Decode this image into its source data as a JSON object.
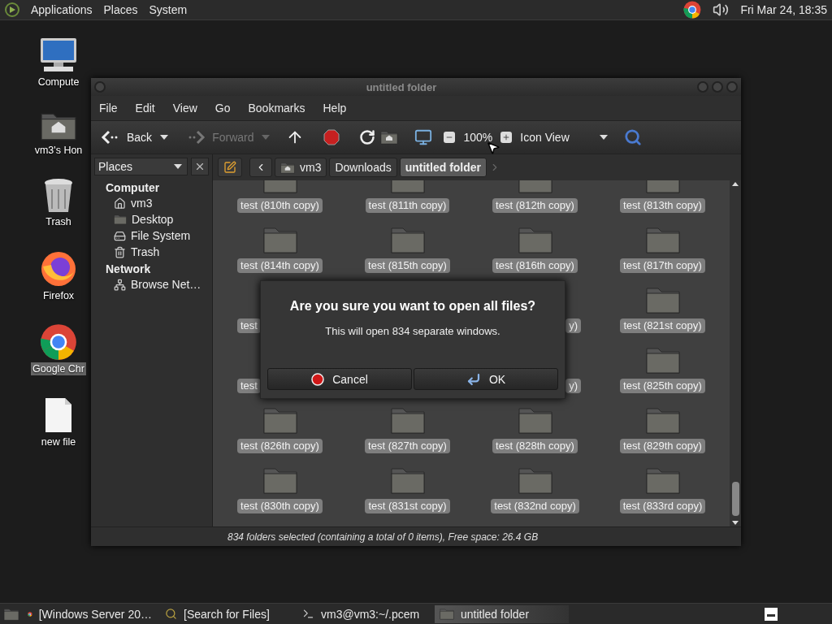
{
  "top_panel": {
    "menus": [
      "Applications",
      "Places",
      "System"
    ],
    "clock": "Fri Mar 24, 18:35"
  },
  "desktop_icons": [
    {
      "kind": "computer",
      "label": "Compute",
      "selected": false
    },
    {
      "kind": "home",
      "label": "vm3's Hon",
      "selected": false
    },
    {
      "kind": "trash",
      "label": "Trash",
      "selected": false
    },
    {
      "kind": "firefox",
      "label": "Firefox",
      "selected": false
    },
    {
      "kind": "chrome",
      "label": "Google Chr",
      "selected": true
    },
    {
      "kind": "file",
      "label": "new file",
      "selected": false
    }
  ],
  "window": {
    "title": "untitled folder",
    "menu": [
      "File",
      "Edit",
      "View",
      "Go",
      "Bookmarks",
      "Help"
    ],
    "toolbar": {
      "back": "Back",
      "forward": "Forward",
      "forward_disabled": true,
      "zoom": "100%",
      "view": "Icon View"
    },
    "sidebar": {
      "header": "Places",
      "sections": [
        {
          "title": "Computer",
          "children": [
            {
              "label": "vm3",
              "kind": "home"
            },
            {
              "label": "Desktop",
              "kind": "desktop"
            },
            {
              "label": "File System",
              "kind": "drive"
            },
            {
              "label": "Trash",
              "kind": "trash"
            }
          ]
        },
        {
          "title": "Network",
          "children": [
            {
              "label": "Browse Net…",
              "kind": "network"
            }
          ]
        }
      ]
    },
    "pathbar": [
      {
        "label": "vm3",
        "kind": "home",
        "selected": false
      },
      {
        "label": "Downloads",
        "kind": "plain",
        "selected": false
      },
      {
        "label": "untitled folder",
        "kind": "plain",
        "selected": true
      }
    ],
    "grid": {
      "rows": [
        [
          {
            "label": "test (810th copy)",
            "kind": "whole",
            "selected": true
          },
          {
            "label": "test (811th copy)",
            "kind": "whole",
            "selected": true
          },
          {
            "label": "test (812th copy)",
            "kind": "whole",
            "selected": true
          },
          {
            "label": "test (813th copy)",
            "kind": "whole",
            "selected": true
          }
        ],
        [
          {
            "label": "test (814th copy)",
            "kind": "whole",
            "selected": true
          },
          {
            "label": "test (815th copy)",
            "kind": "whole",
            "selected": true
          },
          {
            "label": "test (816th copy)",
            "kind": "whole",
            "selected": true
          },
          {
            "label": "test (817th copy)",
            "kind": "whole",
            "selected": true
          }
        ],
        [
          {
            "label": "test",
            "kind": "head",
            "selected": true
          },
          null,
          {
            "label": "y)",
            "kind": "tail",
            "selected": true
          },
          {
            "label": "test (821st copy)",
            "kind": "whole",
            "selected": true
          }
        ],
        [
          {
            "label": "test",
            "kind": "head",
            "selected": true
          },
          null,
          {
            "label": "y)",
            "kind": "tail",
            "selected": true
          },
          {
            "label": "test (825th copy)",
            "kind": "whole",
            "selected": true
          }
        ],
        [
          {
            "label": "test (826th copy)",
            "kind": "whole",
            "selected": true
          },
          {
            "label": "test (827th copy)",
            "kind": "whole",
            "selected": true
          },
          {
            "label": "test (828th copy)",
            "kind": "whole",
            "selected": true
          },
          {
            "label": "test (829th copy)",
            "kind": "whole",
            "selected": true
          }
        ],
        [
          {
            "label": "test (830th copy)",
            "kind": "whole",
            "selected": true
          },
          {
            "label": "test (831st copy)",
            "kind": "whole",
            "selected": true
          },
          {
            "label": "test (832nd copy)",
            "kind": "whole",
            "selected": true
          },
          {
            "label": "test (833rd copy)",
            "kind": "whole",
            "selected": true
          }
        ]
      ]
    },
    "status_bar": "834 folders selected (containing a total of 0 items), Free space: 26.4 GB"
  },
  "dialog": {
    "title": "Are you sure you want to open all files?",
    "message": "This will open 834 separate windows.",
    "buttons": [
      {
        "label": "Cancel",
        "kind": "cancel"
      },
      {
        "label": "OK",
        "kind": "ok"
      }
    ]
  },
  "taskbar": {
    "items": [
      {
        "label": "[Windows Server 20…",
        "kind": "browser",
        "selected": false
      },
      {
        "label": "[Search for Files]",
        "kind": "search",
        "selected": false
      },
      {
        "label": "vm3@vm3:~/.pcem",
        "kind": "terminal",
        "selected": false
      },
      {
        "label": "untitled folder",
        "kind": "folder",
        "selected": true
      }
    ]
  }
}
